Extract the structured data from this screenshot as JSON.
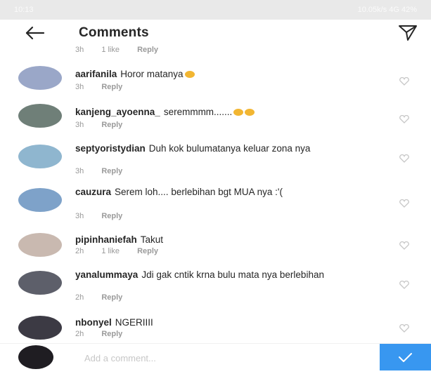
{
  "status_bar": {
    "left": "10:13",
    "right": "10.05k/s 4G 42%"
  },
  "header": {
    "title": "Comments",
    "back_icon": "arrow-left-icon",
    "send_icon": "send-icon"
  },
  "partial_comment": {
    "time": "3h",
    "likes": "1 like",
    "reply": "Reply"
  },
  "comments": [
    {
      "username": "aarifanila",
      "text": "Horor matanya",
      "time": "3h",
      "likes": "",
      "reply": "Reply",
      "avatar_color": "#9aa7c8"
    },
    {
      "username": "kanjeng_ayoenna_",
      "text": "seremmmm.......",
      "time": "3h",
      "likes": "",
      "reply": "Reply",
      "avatar_color": "#6f7f78"
    },
    {
      "username": "septyoristydian",
      "text": "Duh kok bulumatanya keluar zona nya",
      "time": "3h",
      "likes": "",
      "reply": "Reply",
      "avatar_color": "#8fb6cf"
    },
    {
      "username": "cauzura",
      "text": "Serem loh.... berlebihan bgt MUA nya :'(",
      "time": "3h",
      "likes": "",
      "reply": "Reply",
      "avatar_color": "#7ea2c9"
    },
    {
      "username": "pipinhaniefah",
      "text": "Takut",
      "time": "2h",
      "likes": "1 like",
      "reply": "Reply",
      "avatar_color": "#c9b9b0"
    },
    {
      "username": "yanalummaya",
      "text": "Jdi gak cntik krna bulu mata nya berlebihan",
      "time": "2h",
      "likes": "",
      "reply": "Reply",
      "avatar_color": "#5d5f6a"
    },
    {
      "username": "nbonyel",
      "text": "NGERIIII",
      "time": "2h",
      "likes": "",
      "reply": "Reply",
      "avatar_color": "#3c3a44"
    }
  ],
  "composer": {
    "placeholder": "Add a comment...",
    "avatar_color": "#1f1d22",
    "post_color": "#3897f0"
  }
}
